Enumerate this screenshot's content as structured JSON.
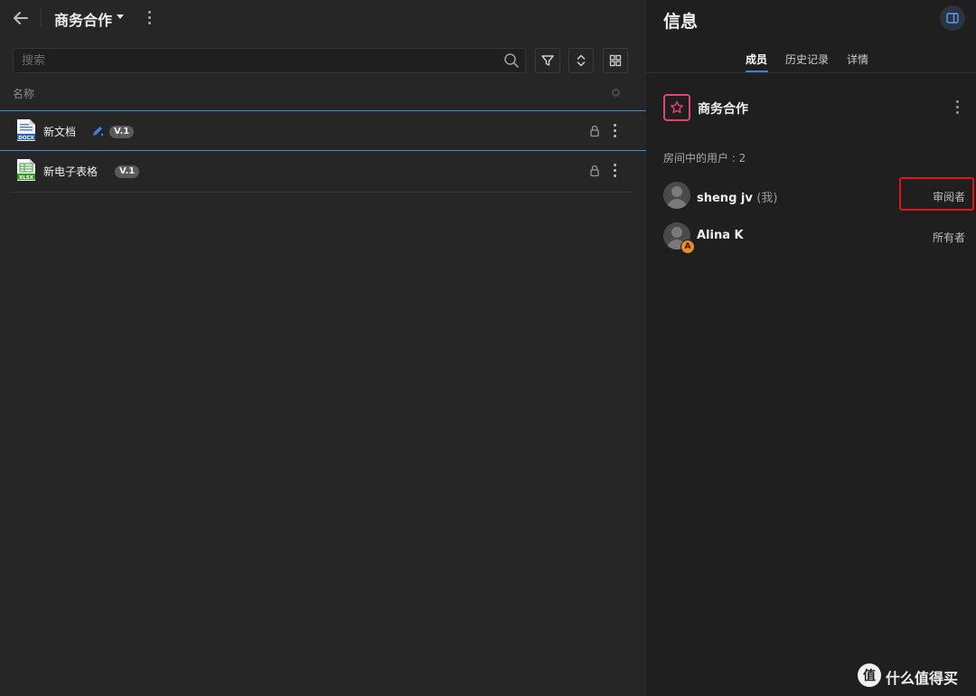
{
  "header": {
    "room_title": "商务合作"
  },
  "toolbar": {
    "search_placeholder": "搜索"
  },
  "file_list": {
    "column_name": "名称",
    "files": [
      {
        "name": "新文档",
        "type_label": "DOCX",
        "version": "V.1",
        "editing": true
      },
      {
        "name": "新电子表格",
        "type_label": "XLSX",
        "version": "V.1",
        "editing": false
      }
    ]
  },
  "info_panel": {
    "title": "信息",
    "tabs": [
      {
        "label": "成员",
        "active": true
      },
      {
        "label": "历史记录",
        "active": false
      },
      {
        "label": "详情",
        "active": false
      }
    ],
    "room_name": "商务合作",
    "users_count_label": "房间中的用户 : 2",
    "users": [
      {
        "name": "sheng jv",
        "me_suffix": "(我)",
        "role": "审阅者",
        "badge": ""
      },
      {
        "name": "Alina K",
        "me_suffix": "",
        "role": "所有者",
        "badge": "A"
      }
    ]
  },
  "watermark": {
    "logo": "值",
    "text": "什么值得买"
  },
  "colors": {
    "accent_blue": "#3d82d6",
    "row_border": "#2f8fd8",
    "room_icon": "#e0456f",
    "owner_badge": "#f08a24",
    "highlight": "#e0151c"
  },
  "icons": {
    "back": "arrow-left-icon",
    "search": "search-icon",
    "filter": "filter-icon",
    "sort": "sort-icon",
    "view": "grid-view-icon",
    "lock": "lock-icon",
    "more": "more-vertical-icon",
    "panel": "panel-toggle-icon",
    "room": "star-icon"
  }
}
